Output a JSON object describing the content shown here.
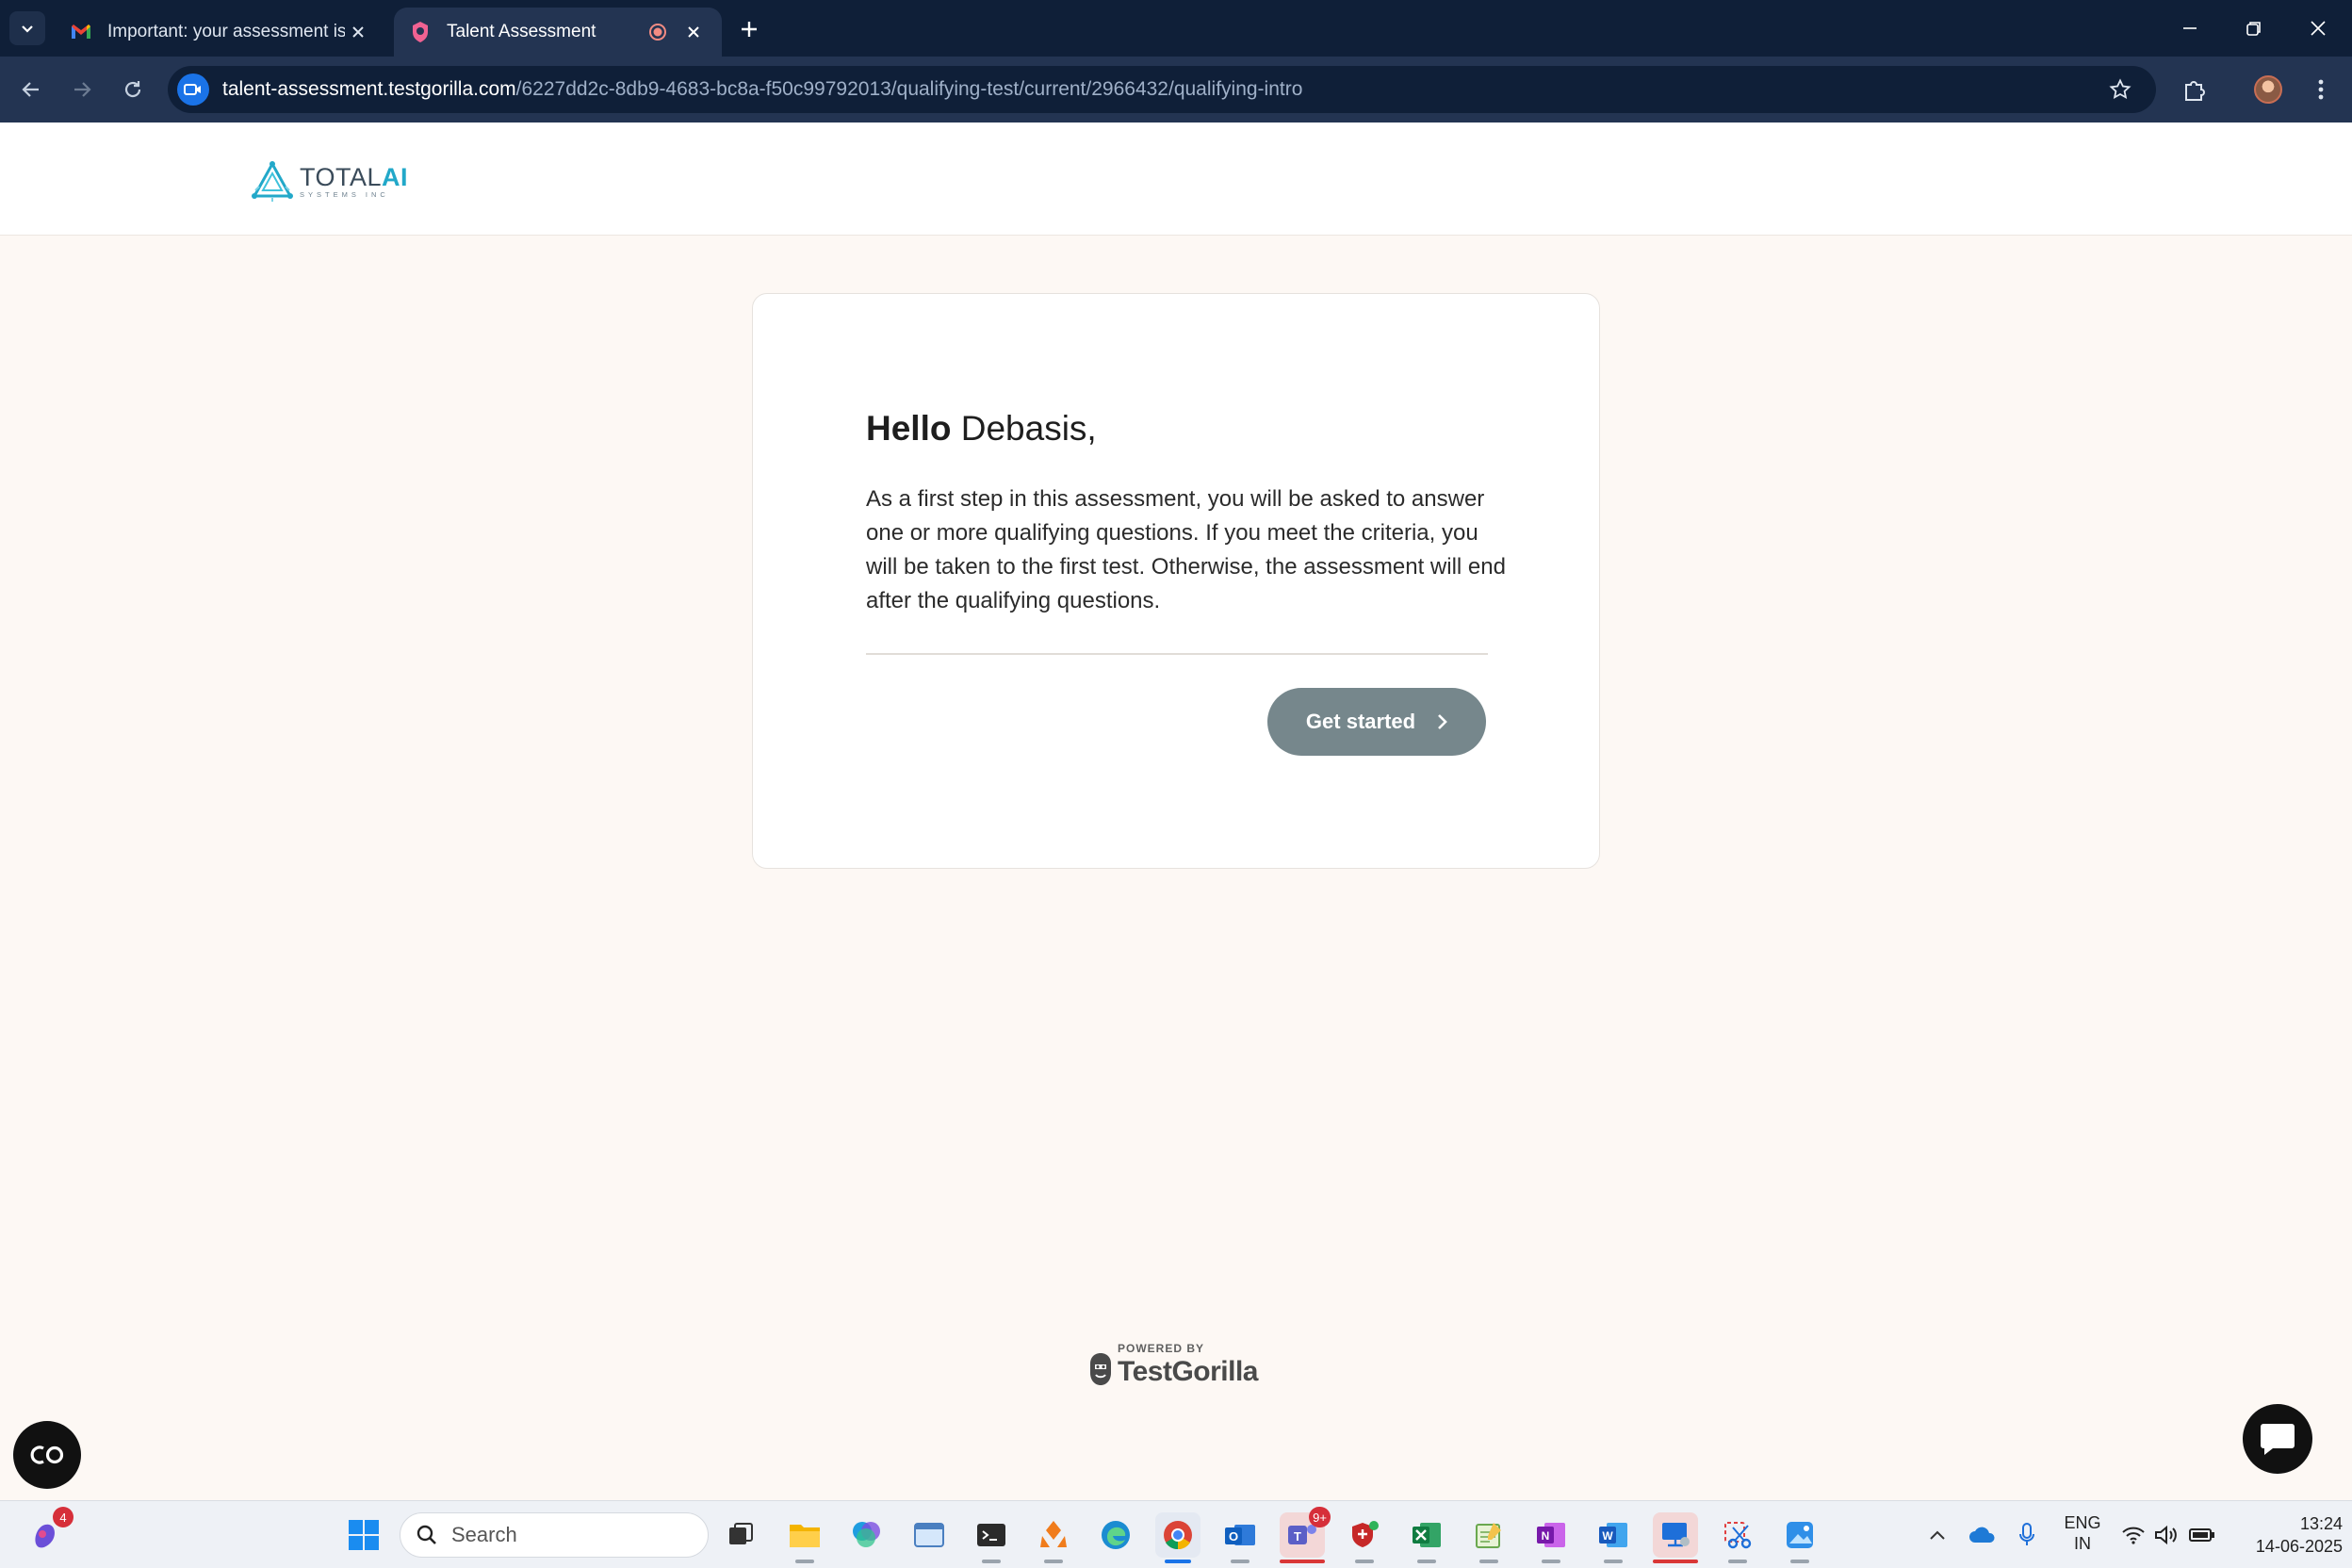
{
  "browser": {
    "tabs": [
      {
        "title": "Important: your assessment is w",
        "favicon": "gmail-icon",
        "active": false
      },
      {
        "title": "Talent Assessment",
        "favicon": "testgorilla-icon",
        "active": true
      }
    ],
    "url_host": "talent-assessment.testgorilla.com",
    "url_path": "/6227dd2c-8db9-4683-bc8a-f50c99792013/qualifying-test/current/2966432/qualifying-intro"
  },
  "header": {
    "logo_main": "TOTAL",
    "logo_accent": "AI",
    "logo_sub": "SYSTEMS INC"
  },
  "card": {
    "greeting_bold": "Hello",
    "greeting_name": "Debasis,",
    "intro": "As a first step in this assessment, you will be asked to answer one or more qualifying questions. If you meet the criteria, you will be taken to the first test. Otherwise, the assessment will end after the qualifying questions.",
    "cta_label": "Get started"
  },
  "footer": {
    "powered_label": "POWERED BY",
    "brand": "TestGorilla"
  },
  "taskbar": {
    "search_placeholder": "Search",
    "copilot_badge": "4",
    "teams_badge": "9+",
    "lang_line1": "ENG",
    "lang_line2": "IN",
    "time": "13:24",
    "date": "14-06-2025"
  },
  "colors": {
    "titlebar": "#0f1f38",
    "toolbar": "#233452",
    "page_bg": "#fdf8f4",
    "cta_bg": "#76878c",
    "logo_accent": "#22a8c9"
  }
}
